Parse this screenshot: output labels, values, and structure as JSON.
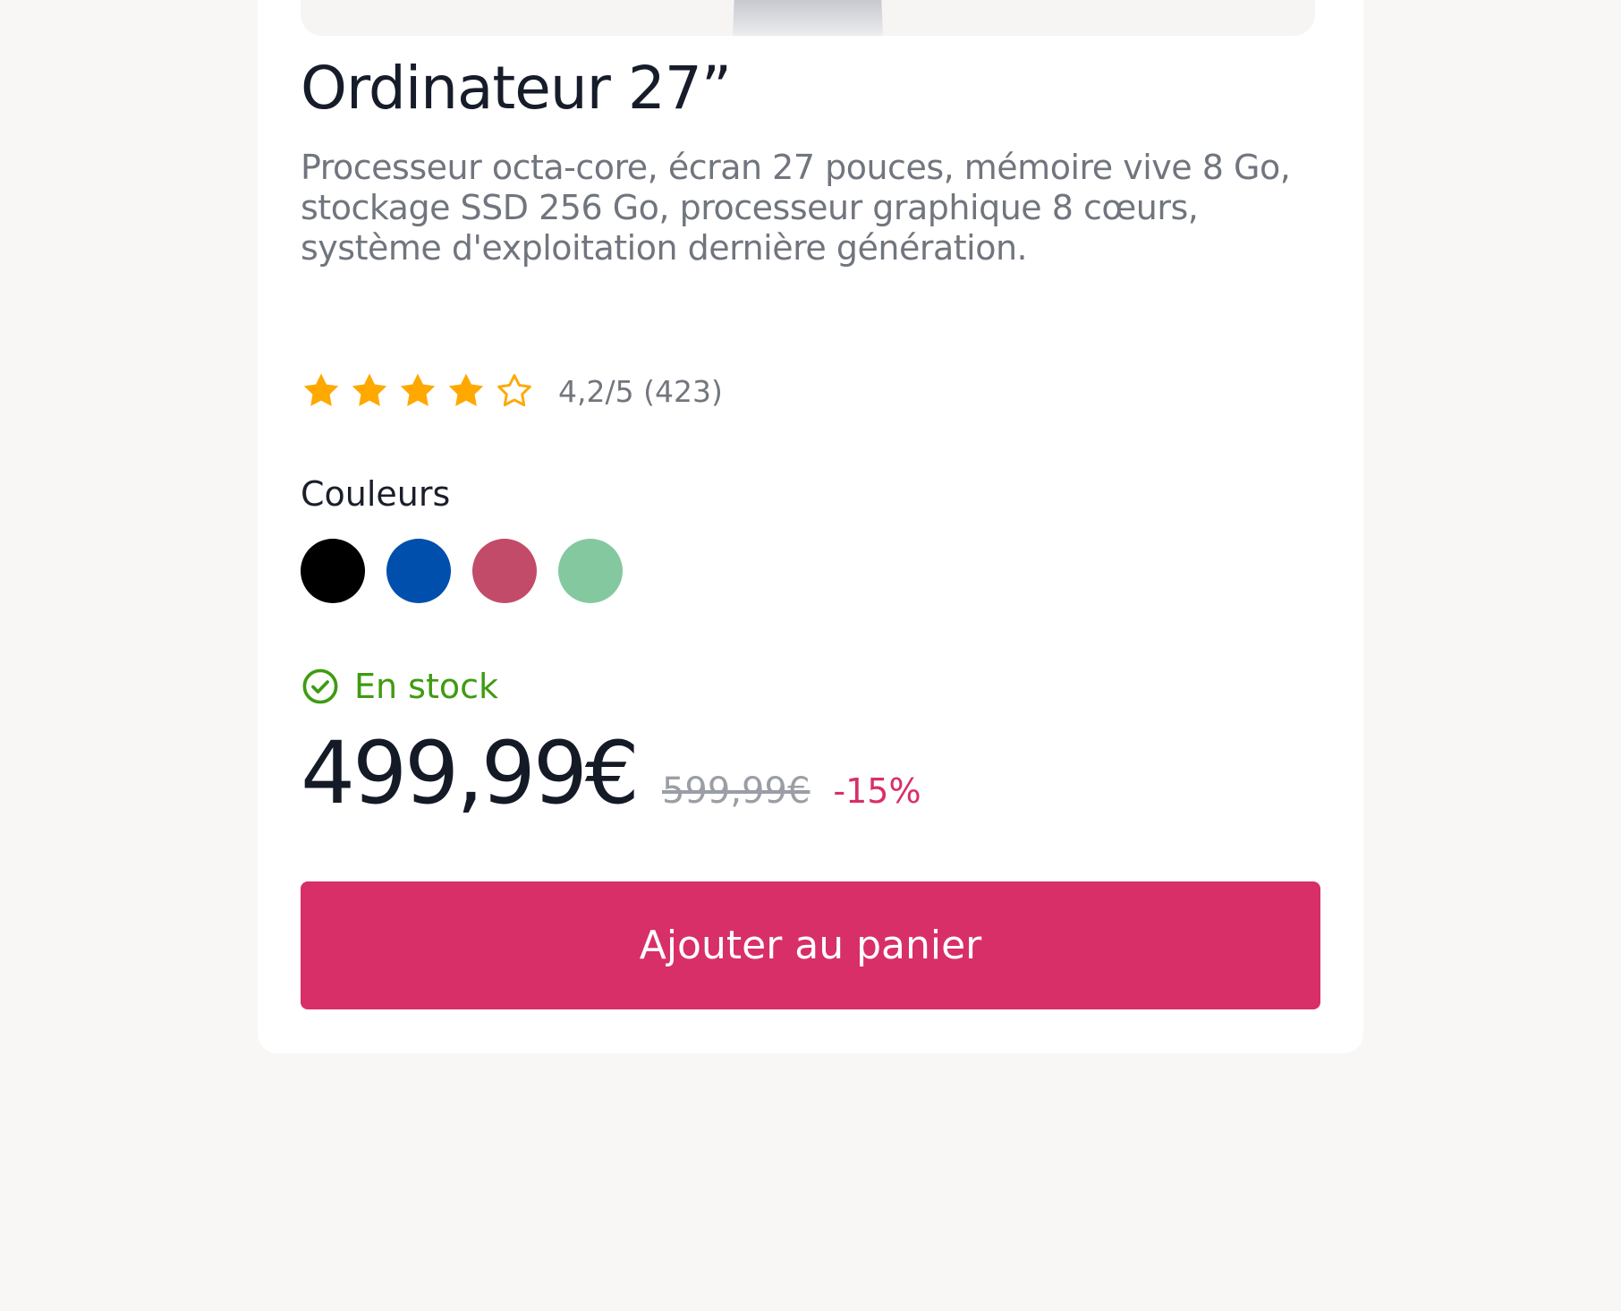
{
  "product": {
    "title": "Ordinateur 27”",
    "description": "Processeur octa-core, écran 27 pouces, mémoire vive 8 Go, stockage SSD 256 Go, processeur graphique 8 cœurs, système d'exploitation dernière génération."
  },
  "rating": {
    "value": 4.2,
    "max": 5,
    "filled_stars": 4,
    "star_icons": [
      "star-filled",
      "star-filled",
      "star-filled",
      "star-filled",
      "star-outline"
    ],
    "text": "4,2/5 (423)"
  },
  "colors": {
    "label": "Couleurs",
    "swatches": [
      {
        "name": "black",
        "hex": "#000000"
      },
      {
        "name": "blue",
        "hex": "#004fad"
      },
      {
        "name": "raspberry",
        "hex": "#c24b6a"
      },
      {
        "name": "mint",
        "hex": "#84c8a0"
      }
    ]
  },
  "stock": {
    "icon": "check-circle",
    "label": "En stock"
  },
  "pricing": {
    "price": "499,99€",
    "old_price": "599,99€",
    "discount": "-15%"
  },
  "cart_button": {
    "label": "Ajouter au panier"
  },
  "theme": {
    "accent": "#d82f69",
    "star": "#ffa800",
    "success": "#3f9b12",
    "text_primary": "#161c2a",
    "text_secondary": "#70757e"
  }
}
